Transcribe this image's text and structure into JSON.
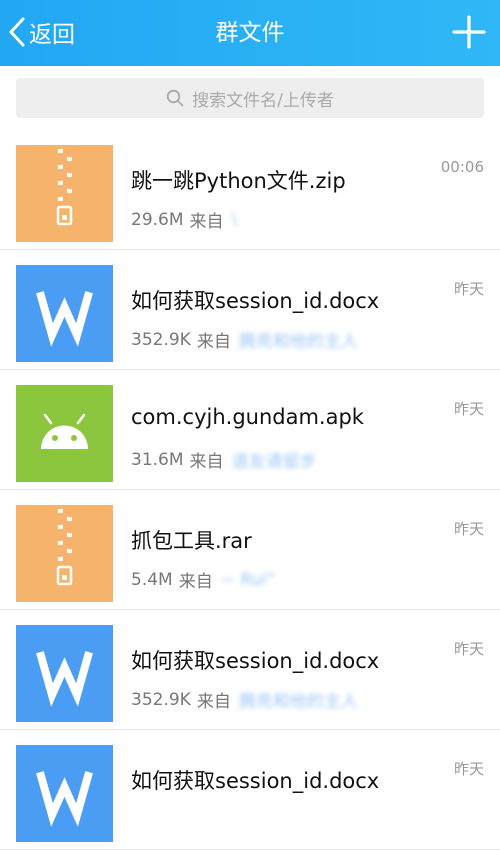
{
  "header": {
    "back_label": "返回",
    "title": "群文件",
    "add_icon": "plus-icon"
  },
  "search": {
    "placeholder": "搜索文件名/上传者",
    "icon": "search-icon"
  },
  "files": [
    {
      "type": "zip",
      "name": "跳一跳Python文件.zip",
      "size": "29.6M",
      "from_label": "来自",
      "uploader": "\\",
      "time": "00:06"
    },
    {
      "type": "doc",
      "name": "如何获取session_id.docx",
      "size": "352.9K",
      "from_label": "来自",
      "uploader": "腾亮和他的主人",
      "time": "昨天"
    },
    {
      "type": "apk",
      "name": "com.cyjh.gundam.apk",
      "size": "31.6M",
      "from_label": "来自",
      "uploader": "道友请留步",
      "time": "昨天"
    },
    {
      "type": "zip",
      "name": "抓包工具.rar",
      "size": "5.4M",
      "from_label": "来自",
      "uploader": "~ Rui\"",
      "time": "昨天"
    },
    {
      "type": "doc",
      "name": "如何获取session_id.docx",
      "size": "352.9K",
      "from_label": "来自",
      "uploader": "腾亮和他的主人",
      "time": "昨天"
    },
    {
      "type": "doc",
      "name": "如何获取session_id.docx",
      "size": "",
      "from_label": "",
      "uploader": "",
      "time": "昨天"
    }
  ],
  "colors": {
    "header": "#2fb3f5",
    "zip": "#f5b36b",
    "doc": "#4a9df3",
    "apk": "#8cc63f"
  }
}
